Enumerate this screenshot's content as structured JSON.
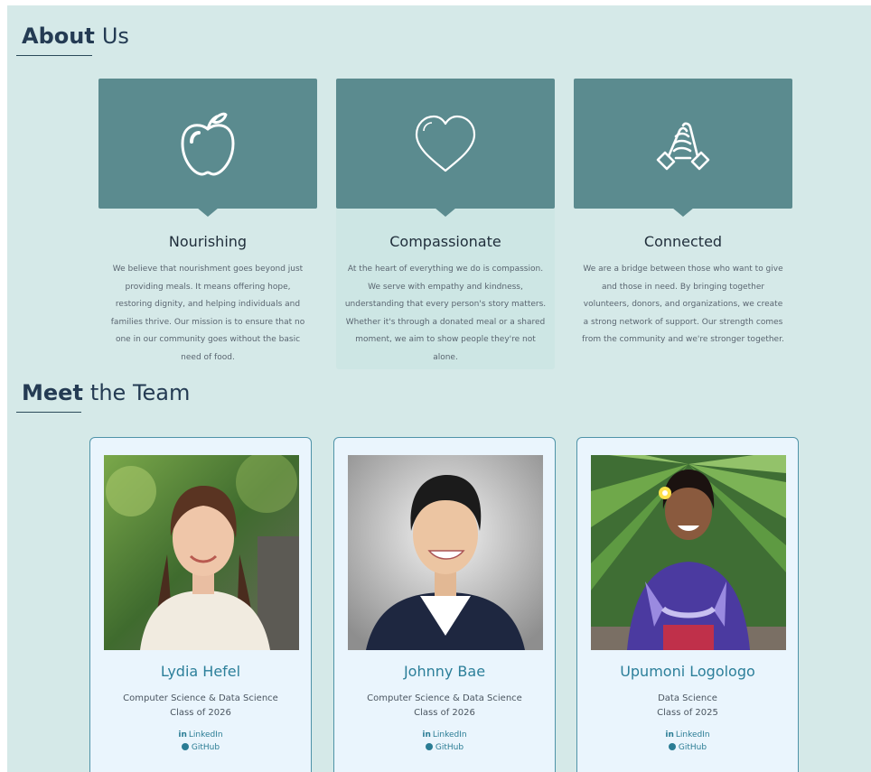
{
  "about": {
    "title_strong": "About",
    "title_rest": "Us",
    "cards": [
      {
        "icon": "apple-icon",
        "title": "Nourishing",
        "text": "We believe that nourishment goes beyond just providing meals. It means offering hope, restoring dignity, and helping individuals and families thrive. Our mission is to ensure that no one in our community goes without the basic need of food."
      },
      {
        "icon": "heart-icon",
        "title": "Compassionate",
        "text": "At the heart of everything we do is compassion. We serve with empathy and kindness, understanding that every person's story matters. Whether it's through a donated meal or a shared moment, we aim to show people they're not alone."
      },
      {
        "icon": "handshake-icon",
        "title": "Connected",
        "text": "We are a bridge between those who want to give and those in need. By bringing together volunteers, donors, and organizations, we create a strong network of support. Our strength comes from the community and we're stronger together."
      }
    ]
  },
  "team": {
    "title_strong": "Meet",
    "title_rest": "the Team",
    "members": [
      {
        "name": "Lydia Hefel",
        "major": "Computer Science & Data Science",
        "class_year": "Class of 2026",
        "linkedin_label": "LinkedIn",
        "github_label": "GitHub"
      },
      {
        "name": "Johnny Bae",
        "major": "Computer Science & Data Science",
        "class_year": "Class of 2026",
        "linkedin_label": "LinkedIn",
        "github_label": "GitHub"
      },
      {
        "name": "Upumoni Logologo",
        "major": "Data Science",
        "class_year": "Class of 2025",
        "linkedin_label": "LinkedIn",
        "github_label": "GitHub"
      }
    ]
  },
  "colors": {
    "page_background": "#d5e9e8",
    "banner": "#5b8b8f",
    "accent": "#2c7f9a",
    "card_background": "#eaf5fd"
  }
}
